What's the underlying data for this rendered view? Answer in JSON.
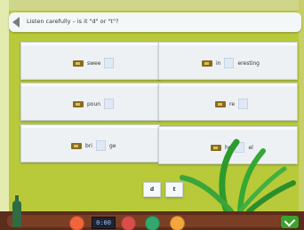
{
  "instruction": "Listen carefully – is it \"d\" or \"t\"?",
  "cards": [
    {
      "pre": "swee",
      "post": ""
    },
    {
      "pre": "in",
      "post": "eresting"
    },
    {
      "pre": "poun",
      "post": ""
    },
    {
      "pre": "re",
      "post": ""
    },
    {
      "pre": "bri",
      "post": "ge"
    },
    {
      "pre": "ho",
      "post": "el"
    }
  ],
  "choices": [
    {
      "label": "d"
    },
    {
      "label": "t"
    }
  ],
  "clock": "0:00",
  "colors": {
    "background": "#b8c93a",
    "card": "#edf1f3",
    "bottom_bar": "#5b2d1d",
    "ok": "#3ca12d"
  },
  "icons": [
    "speaker-icon",
    "rewind-icon",
    "play-icon",
    "next-icon",
    "check-icon"
  ]
}
